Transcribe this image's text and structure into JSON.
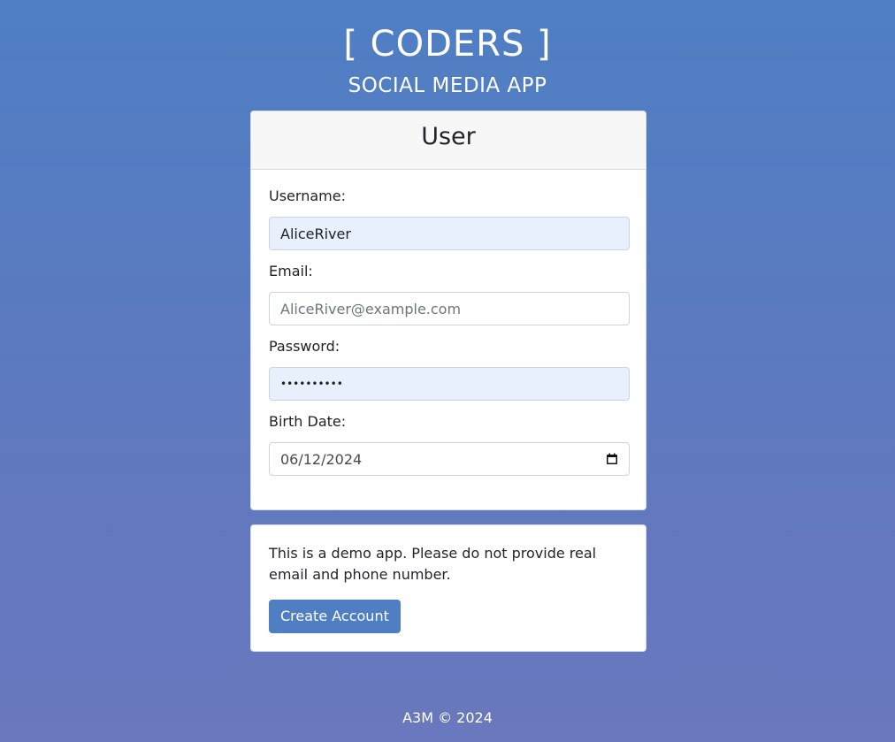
{
  "header": {
    "title": "[ CODERS ]",
    "subtitle": "SOCIAL MEDIA APP"
  },
  "user_card": {
    "title": "User",
    "fields": {
      "username": {
        "label": "Username:",
        "value": "AliceRiver"
      },
      "email": {
        "label": "Email:",
        "placeholder": "AliceRiver@example.com",
        "value": ""
      },
      "password": {
        "label": "Password:",
        "masked_value": "••••••••••"
      },
      "birth_date": {
        "label": "Birth Date:",
        "value": "06/12/2024",
        "icon": "calendar-icon"
      }
    }
  },
  "info_card": {
    "notice": "This is a demo app. Please do not provide real email and phone number.",
    "create_button": "Create Account"
  },
  "footer": {
    "text": "A3M © 2024"
  },
  "colors": {
    "background_top": "#4f7fc4",
    "background_bottom": "#6a78bd",
    "button": "#4f7fc2",
    "autofill": "#e8f0fe"
  }
}
